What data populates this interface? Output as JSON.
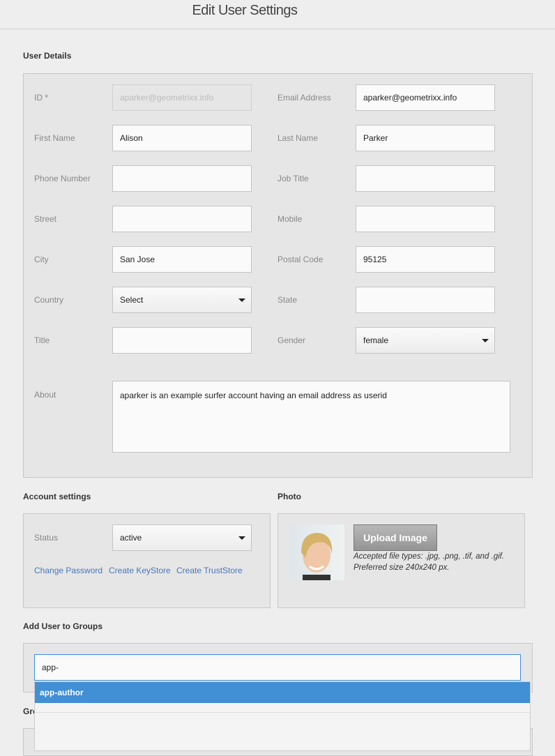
{
  "header": {
    "title": "Edit User Settings"
  },
  "user_details": {
    "heading": "User Details",
    "fields": [
      {
        "label": "ID *",
        "value": "aparker@geometrixx.info",
        "disabled": true
      },
      {
        "label": "Email Address",
        "value": "aparker@geometrixx.info"
      },
      {
        "label": "First Name",
        "value": "Alison"
      },
      {
        "label": "Last Name",
        "value": "Parker"
      },
      {
        "label": "Phone Number",
        "value": ""
      },
      {
        "label": "Job Title",
        "value": ""
      },
      {
        "label": "Street",
        "value": ""
      },
      {
        "label": "Mobile",
        "value": ""
      },
      {
        "label": "City",
        "value": "San Jose"
      },
      {
        "label": "Postal Code",
        "value": "95125"
      },
      {
        "label": "Country",
        "value": "Select",
        "select": true
      },
      {
        "label": "State",
        "value": ""
      },
      {
        "label": "Title",
        "value": ""
      },
      {
        "label": "Gender",
        "value": "female",
        "select": true
      }
    ],
    "about": {
      "label": "About",
      "value": "aparker is an example surfer account having an email address as userid"
    }
  },
  "account": {
    "heading": "Account settings",
    "status_label": "Status",
    "status_value": "active",
    "links": [
      "Change Password",
      "Create KeyStore",
      "Create TrustStore"
    ]
  },
  "photo": {
    "heading": "Photo",
    "upload_label": "Upload Image",
    "hint1": "Accepted file types: .jpg, .png, .tif, and .gif.",
    "hint2": "Preferred size 240x240 px."
  },
  "groups": {
    "heading": "Add User to Groups",
    "input_value": "app-",
    "suggestions": [
      "app-author"
    ],
    "next_heading": "Gro"
  },
  "colors": {
    "accent": "#418fd5",
    "link": "#4b76b8"
  }
}
